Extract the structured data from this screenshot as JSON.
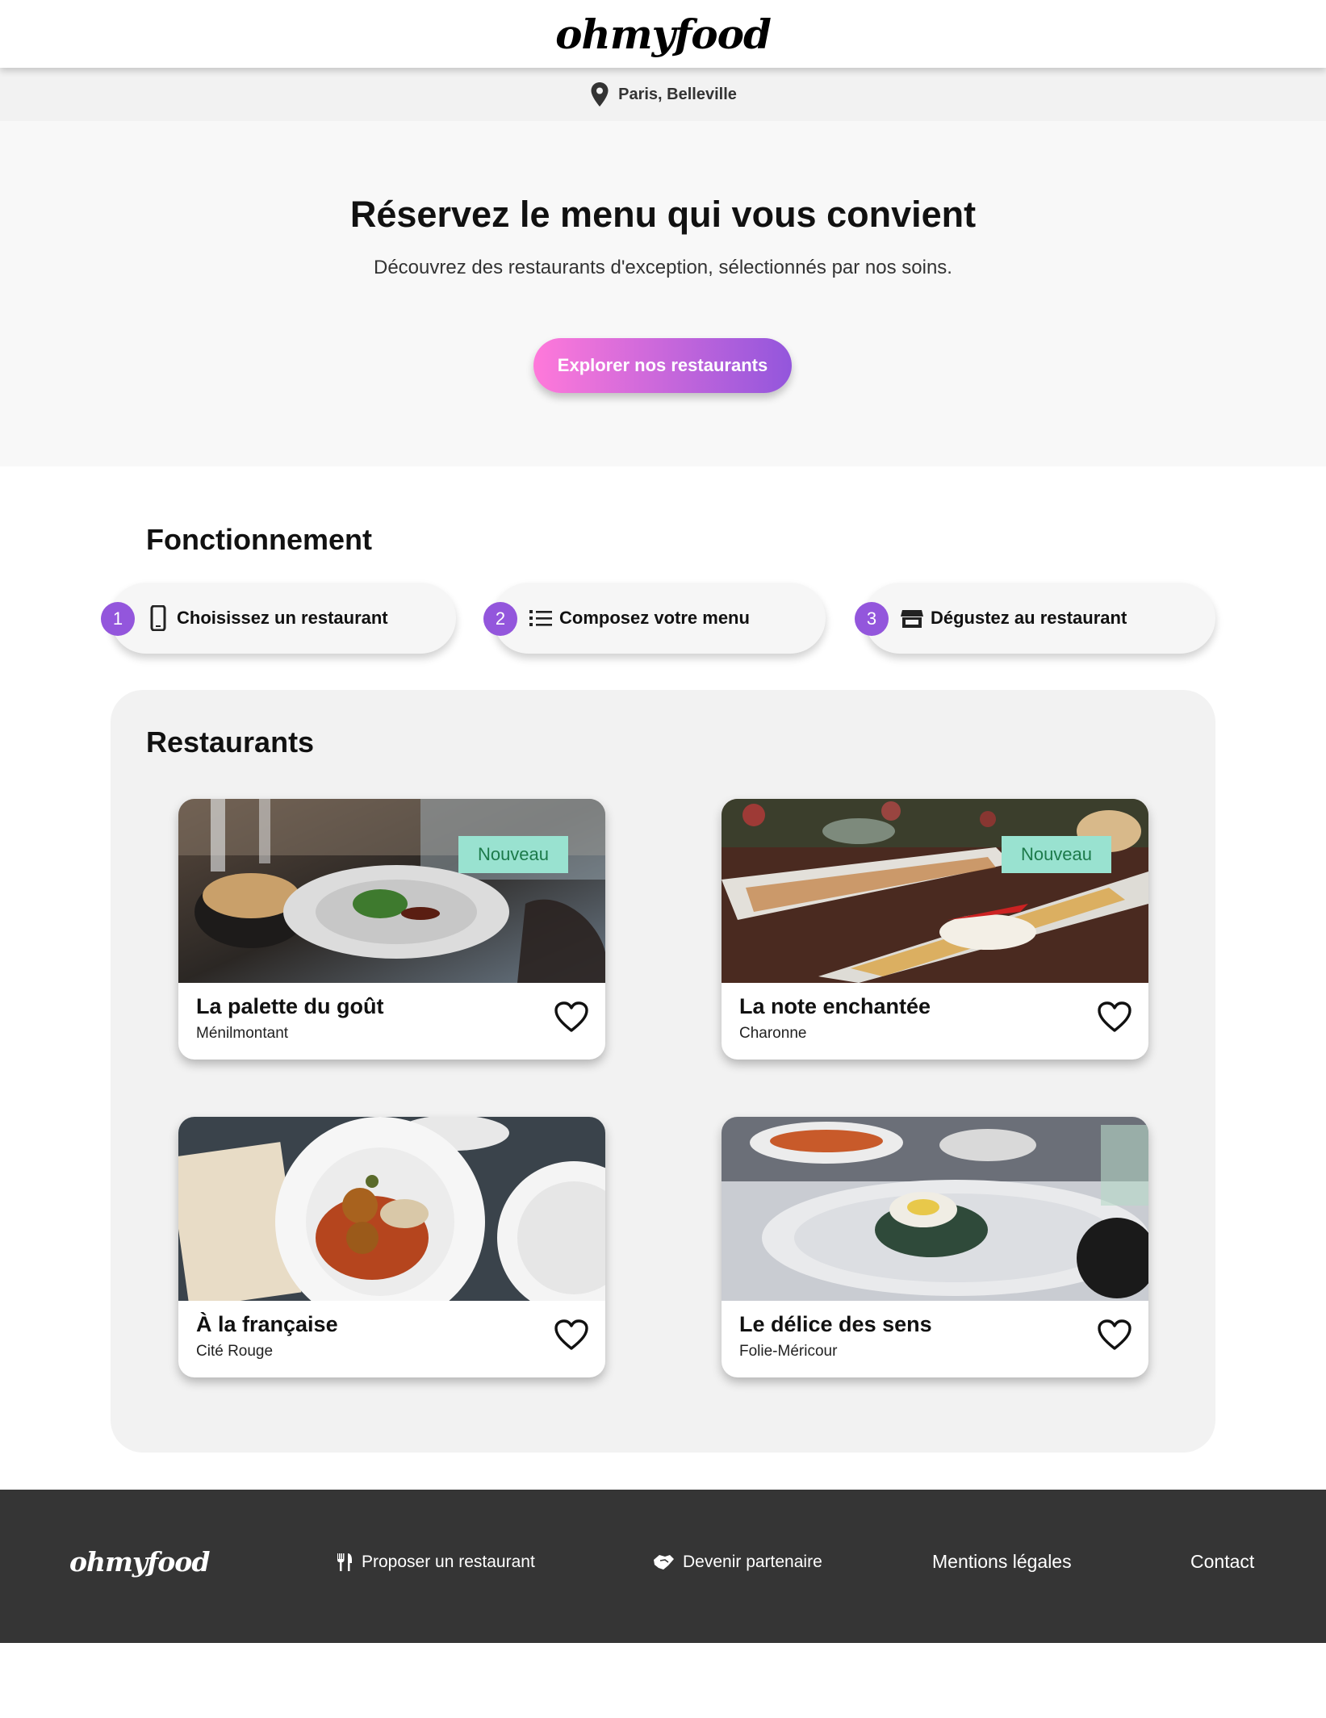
{
  "header": {
    "logo": "ohmyfood"
  },
  "location": {
    "text": "Paris, Belleville",
    "icon": "map-pin-icon"
  },
  "hero": {
    "title": "Réservez le menu qui vous convient",
    "subtitle": "Découvrez des restaurants d'exception, sélectionnés par nos soins.",
    "cta_label": "Explorer nos restaurants",
    "cta_gradient": [
      "#ff79da",
      "#9356dc"
    ]
  },
  "how_it_works": {
    "title": "Fonctionnement",
    "steps": [
      {
        "number": "1",
        "label": "Choisissez un restaurant",
        "icon": "mobile-phone-icon"
      },
      {
        "number": "2",
        "label": "Composez votre menu",
        "icon": "list-icon"
      },
      {
        "number": "3",
        "label": "Dégustez au restaurant",
        "icon": "storefront-icon"
      }
    ],
    "accent_color": "#9356dc"
  },
  "restaurants": {
    "title": "Restaurants",
    "badge_label": "Nouveau",
    "items": [
      {
        "name": "La palette du goût",
        "area": "Ménilmontant",
        "is_new": true
      },
      {
        "name": "La note enchantée",
        "area": "Charonne",
        "is_new": true
      },
      {
        "name": "À la française",
        "area": "Cité Rouge",
        "is_new": false
      },
      {
        "name": "Le délice des sens",
        "area": "Folie-Méricour",
        "is_new": false
      }
    ]
  },
  "footer": {
    "logo": "ohmyfood",
    "links": [
      {
        "label": "Proposer un restaurant",
        "icon": "utensils-icon"
      },
      {
        "label": "Devenir partenaire",
        "icon": "handshake-icon"
      },
      {
        "label": "Mentions légales"
      },
      {
        "label": "Contact"
      }
    ]
  }
}
